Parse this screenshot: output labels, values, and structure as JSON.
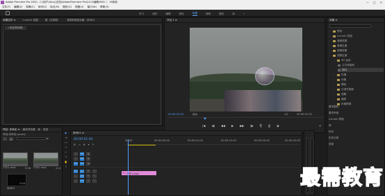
{
  "titlebar": {
    "title": "Adobe Premiere Pro 2020 - C:\\用户\\Ahzy\\文档\\Adobe\\Premiere Pro\\14.0\\编辑1691 ！ 16收纳",
    "window_controls": [
      "—",
      "□",
      "✕"
    ]
  },
  "menubar": {
    "items": [
      "文件(F)",
      "编辑(E)",
      "剪辑(C)",
      "序列(S)",
      "标记(M)",
      "图形(G)",
      "视图(V)",
      "窗口(W)",
      "帮助(H)"
    ]
  },
  "workspaces": {
    "tabs": [
      "学习",
      "组件",
      "编辑",
      "颜色",
      "效果",
      "音频",
      "图形",
      "库"
    ],
    "active": "效果",
    "more": "»"
  },
  "effects_panel": {
    "tabs": [
      "效果控件 ≡",
      "Lumetri 范围",
      "源（无剪辑）",
      "音频剪辑混合器：序列01"
    ],
    "active_tab": "效果控件 ≡",
    "placeholder": "（未选择剪辑）"
  },
  "program_panel": {
    "title": "节目 1 ≡",
    "timecode_left": "00:00:01:04",
    "fit": "适合",
    "fraction": "1/2",
    "timecode_right": "00:00:01:05",
    "controls": [
      "|◀",
      "◀|",
      "◀◀",
      "▶",
      "▶▶",
      "|▶",
      "⎘",
      "⎙",
      "◉"
    ],
    "add": "+"
  },
  "project_panel": {
    "tabs": [
      "项目: 未命名 ≡",
      "媒体浏览器",
      "库",
      "信息"
    ],
    "project_name": "项目(未命名).prproj",
    "count": "1 项已选择，共 2 项",
    "clips": [
      {
        "name": "户外1.mp4",
        "duration": "5:08"
      },
      {
        "name": "户外2.mp4",
        "duration": "4:11"
      },
      {
        "name": "序列01",
        "duration": "1:04"
      }
    ]
  },
  "timeline_panel": {
    "tab": "序列01 ≡",
    "timecode": "00:00:01:04",
    "ruler": [
      "00:00",
      "00:00:05:00",
      "00:00:10:00",
      "00:00:15:00",
      "00:00:20:00",
      "00:00:25:00"
    ],
    "tracks": [
      {
        "id": "V3"
      },
      {
        "id": "V2"
      },
      {
        "id": "V1"
      },
      {
        "id": "A1"
      },
      {
        "id": "A2"
      },
      {
        "id": "A3"
      }
    ],
    "clip_label": "户外1.mp4",
    "clip_prefix": "fx"
  },
  "tools": [
    "▶",
    "⇉",
    "⟷",
    "✂",
    "⊢",
    "✎",
    "✋",
    "T"
  ],
  "right_panel": {
    "title": "效果 ≡",
    "tree": [
      {
        "label": "预设",
        "level": 0
      },
      {
        "label": "Lumetri 预设",
        "level": 0
      },
      {
        "label": "音频效果",
        "level": 0
      },
      {
        "label": "音频过渡",
        "level": 0
      },
      {
        "label": "视频效果",
        "level": 0
      },
      {
        "label": "视频过渡",
        "level": 0
      },
      {
        "label": "3D 运动",
        "level": 1
      },
      {
        "label": "立方体旋转",
        "level": 2
      },
      {
        "label": "翻转",
        "level": 2,
        "selected": true
      },
      {
        "label": "内滑",
        "level": 1
      },
      {
        "label": "划像",
        "level": 1
      },
      {
        "label": "擦除",
        "level": 1
      },
      {
        "label": "沉浸式视频",
        "level": 1
      },
      {
        "label": "溶解",
        "level": 1
      },
      {
        "label": "缩放",
        "level": 1
      },
      {
        "label": "页面剥落",
        "level": 1
      }
    ],
    "sections": [
      "基本图形",
      "基本声音",
      "Lumetri 颜色",
      "库",
      "标记",
      "历史记录",
      "信息"
    ]
  },
  "watermark": "最需教育"
}
